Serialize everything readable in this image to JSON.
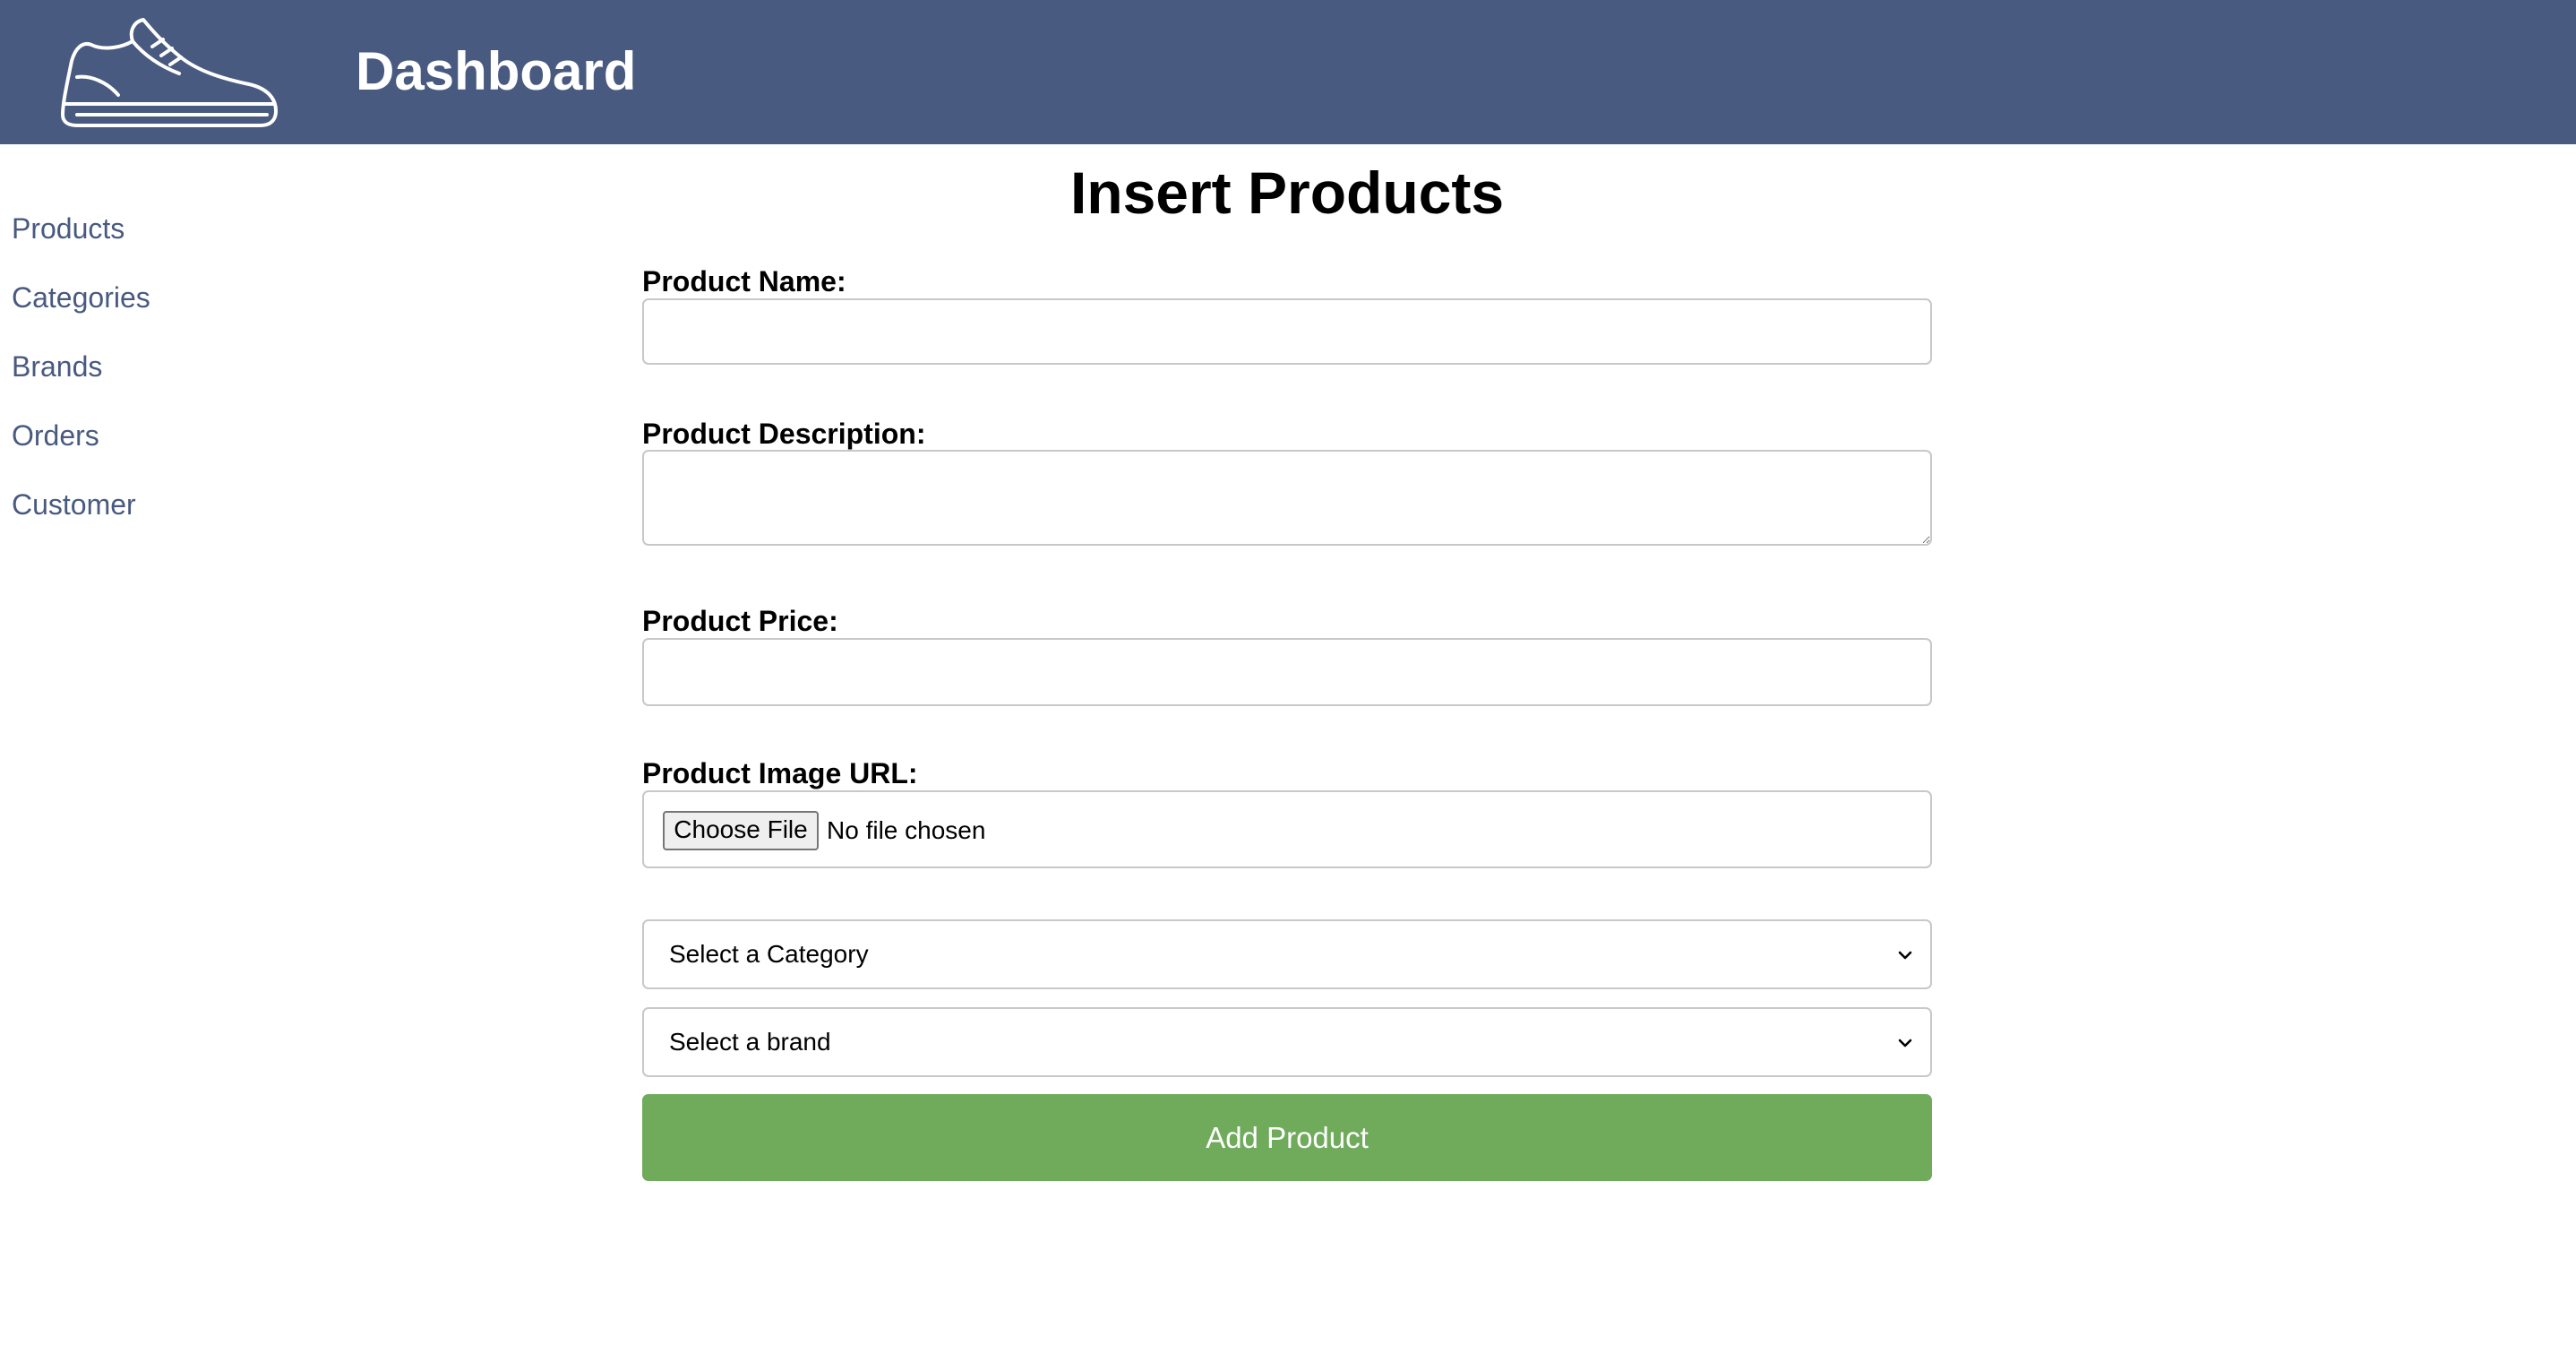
{
  "header": {
    "logo_icon": "sneaker-logo-icon",
    "title": "Dashboard",
    "background_color": "#495a80"
  },
  "sidebar": {
    "items": [
      {
        "label": "Products"
      },
      {
        "label": "Categories"
      },
      {
        "label": "Brands"
      },
      {
        "label": "Orders"
      },
      {
        "label": "Customer"
      }
    ]
  },
  "form": {
    "title": "Insert Products",
    "product_name": {
      "label": "Product Name:",
      "value": ""
    },
    "product_description": {
      "label": "Product Description:",
      "value": ""
    },
    "product_price": {
      "label": "Product Price:",
      "value": ""
    },
    "product_image": {
      "label": "Product Image URL:",
      "button_label": "Choose File",
      "status": "No file chosen"
    },
    "category_select": {
      "selected": "Select a Category",
      "icon": "chevron-down-icon"
    },
    "brand_select": {
      "selected": "Select a brand",
      "icon": "chevron-down-icon"
    },
    "submit_label": "Add Product",
    "submit_color": "#6fab5b"
  }
}
